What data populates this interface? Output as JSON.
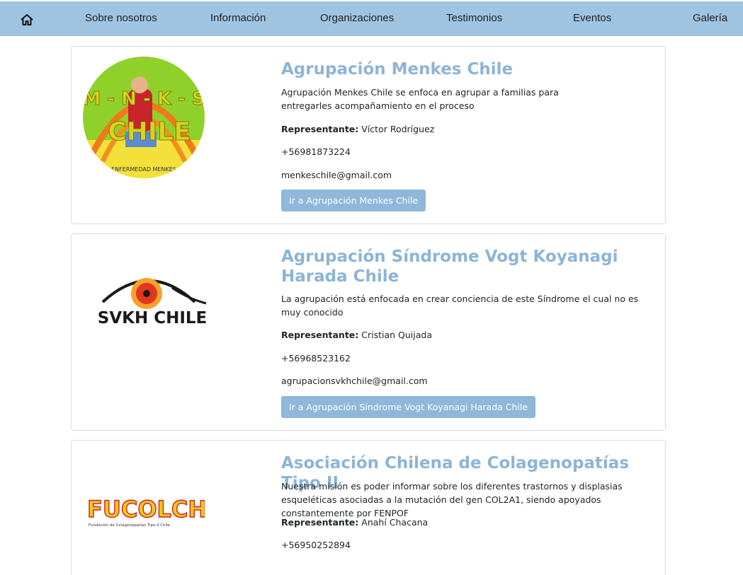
{
  "nav": {
    "home_icon": "home-icon",
    "items": [
      "Sobre nosotros",
      "Información",
      "Organizaciones",
      "Testimonios",
      "Eventos",
      "Galería"
    ]
  },
  "cards": [
    {
      "logo_icon": "menkes-logo",
      "logo_text_top": "M - N - K - S",
      "logo_text_bottom": "CHILE",
      "logo_footer": "ENFERMEDAD MENKES",
      "title": "Agrupación Menkes Chile",
      "description": "Agrupación Menkes Chile se enfoca en agrupar a familias para entregarles acompañamiento en el proceso",
      "rep_label": "Representante:",
      "representative": "Víctor Rodríguez",
      "phone": "+56981873224",
      "email": "menkeschile@gmail.com",
      "button": "Ir a Agrupación Menkes Chile"
    },
    {
      "logo_icon": "svkh-eye-logo",
      "logo_text": "SVKH CHILE",
      "title": "Agrupación Síndrome Vogt Koyanagi Harada Chile",
      "description": "La agrupación está enfocada en crear conciencia de este Síndrome el cual no es muy conocido",
      "rep_label": "Representante:",
      "representative": "Cristian Quijada",
      "phone": "+56968523162",
      "email": "agrupacionsvkhchile@gmail.com",
      "button": "Ir a Agrupación Síndrome Vogt Koyanagi Harada Chile"
    },
    {
      "logo_icon": "fucolch-logo",
      "logo_text": "FUCOLCH",
      "logo_subtext": "Fundación de Colagenopatías Tipo II Chile",
      "title": "Asociación Chilena de Colagenopatías Tipo II",
      "description": "Nuestra misión es poder informar sobre los diferentes trastornos y displasias esqueléticas asociadas a la mutación del gen COL2A1, siendo apoyados constantemente por FENPOF",
      "rep_label": "Representante:",
      "representative": "Anahí Chacana",
      "phone": "+56950252894"
    }
  ]
}
